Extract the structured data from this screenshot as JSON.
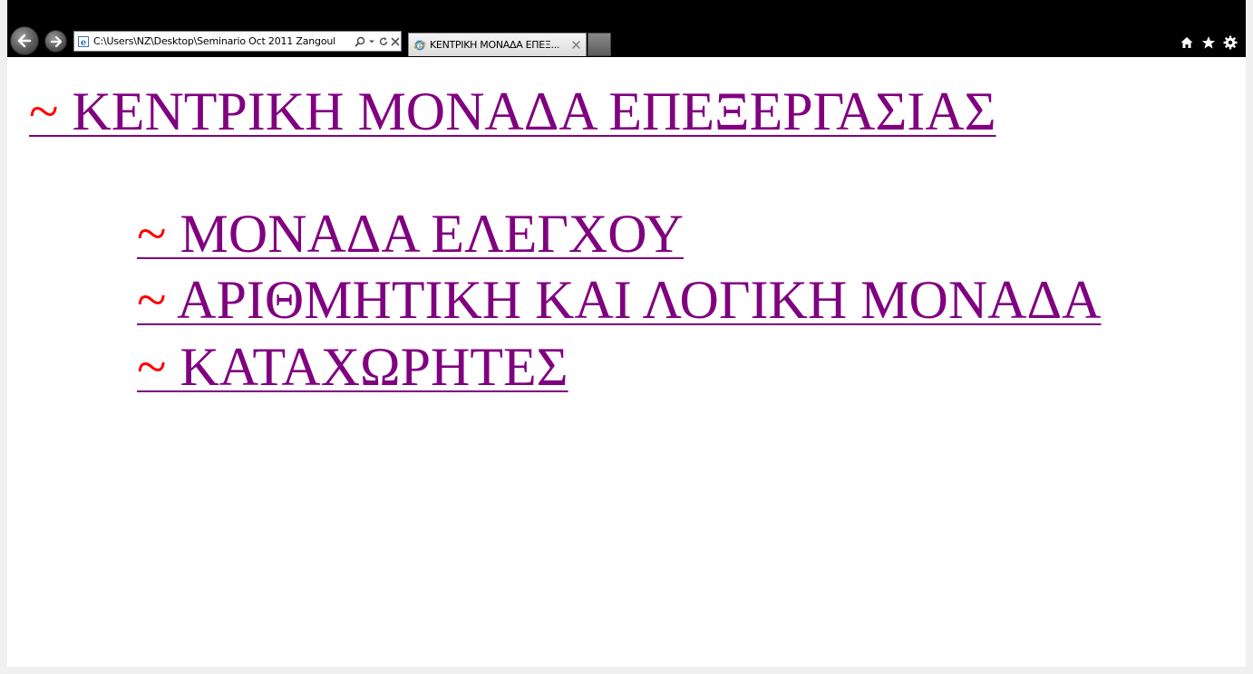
{
  "browser": {
    "address": "C:\\Users\\NZ\\Desktop\\Seminario Oct 2011 Zangoul",
    "tab_title": "ΚΕΝΤΡΙΚΗ ΜΟΝΑΔΑ ΕΠΕΞ...",
    "icons": {
      "back": "back-arrow-icon",
      "forward": "forward-arrow-icon",
      "search": "search-icon",
      "dropdown": "chevron-down-icon",
      "refresh": "refresh-icon",
      "stop": "close-icon",
      "home": "home-icon",
      "favorites": "star-icon",
      "tools": "gear-icon"
    }
  },
  "page": {
    "bullet": "~",
    "main_link": "ΚΕΝΤΡΙΚΗ ΜΟΝΑΔΑ ΕΠΕΞΕΡΓΑΣΙΑΣ",
    "sub_links": [
      "ΜΟΝΑΔΑ ΕΛΕΓΧΟΥ",
      "ΑΡΙΘΜΗΤΙΚΗ ΚΑΙ ΛΟΓΙΚΗ ΜΟΝΑΔΑ",
      "ΚΑΤΑΧΩΡΗΤΕΣ"
    ]
  },
  "colors": {
    "link": "#800080",
    "bullet": "#ff0000",
    "toolbar": "#000000",
    "background": "#ffffff"
  }
}
